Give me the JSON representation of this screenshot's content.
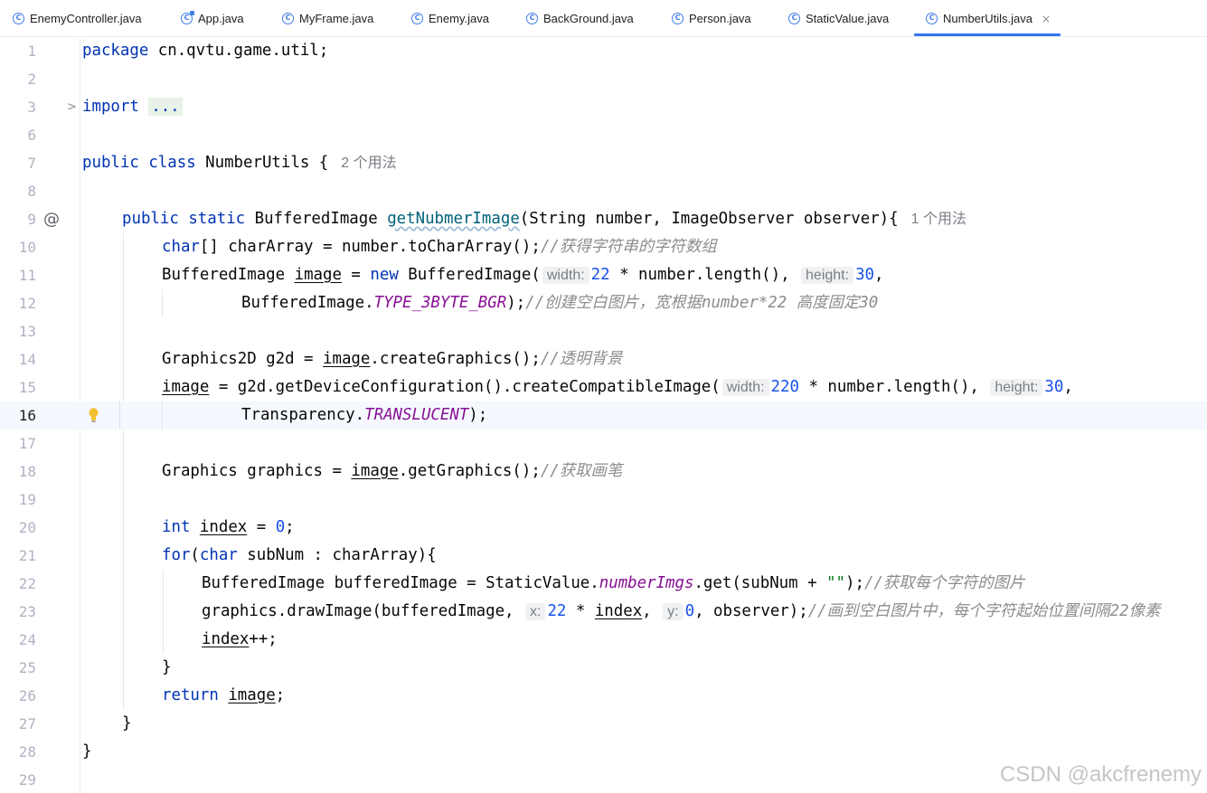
{
  "tabs": [
    {
      "label": "EnemyController.java",
      "icon": "class-icon"
    },
    {
      "label": "App.java",
      "icon": "app-class-icon"
    },
    {
      "label": "MyFrame.java",
      "icon": "class-icon"
    },
    {
      "label": "Enemy.java",
      "icon": "class-icon"
    },
    {
      "label": "BackGround.java",
      "icon": "class-icon"
    },
    {
      "label": "Person.java",
      "icon": "class-icon"
    },
    {
      "label": "StaticValue.java",
      "icon": "class-icon"
    },
    {
      "label": "NumberUtils.java",
      "icon": "class-icon",
      "active": true
    }
  ],
  "tab_close_glyph": "×",
  "active_tab_color": "#3574f0",
  "gutter": {
    "at_symbol": "@",
    "fold_arrow": ">"
  },
  "line_numbers": [
    "1",
    "2",
    "3",
    "6",
    "7",
    "8",
    "9",
    "10",
    "11",
    "12",
    "13",
    "14",
    "15",
    "16",
    "17",
    "18",
    "19",
    "20",
    "21",
    "22",
    "23",
    "24",
    "25",
    "26",
    "27",
    "28",
    "29"
  ],
  "current_line": "16",
  "code": {
    "l1": {
      "kw": "package",
      "rest": " cn.qvtu.game.util;"
    },
    "l3": {
      "kw": "import",
      "dots": "..."
    },
    "l7": {
      "kw1": "public",
      "kw2": "class",
      "name": " NumberUtils {",
      "usage": "2 个用法"
    },
    "l9": {
      "kw1": "public",
      "kw2": "static",
      "type": " BufferedImage ",
      "fn": "getNubmerImage",
      "params": "(String number, ImageObserver observer){",
      "usage": "1 个用法"
    },
    "l10": {
      "kw": "char",
      "rest": "[] charArray = number.toCharArray();",
      "comment": "//获得字符串的字符数组"
    },
    "l11": {
      "pre": "BufferedImage ",
      "var": "image",
      "mid": " = ",
      "kw": "new",
      "mid2": " BufferedImage(",
      "hint1": "width:",
      "num1": "22",
      "mid3": " * number.length(), ",
      "hint2": "height:",
      "num2": "30",
      "end": ","
    },
    "l12": {
      "pre": "BufferedImage.",
      "const": "TYPE_3BYTE_BGR",
      "end": ");",
      "comment": "//创建空白图片，宽根据number*22 高度固定30"
    },
    "l14": {
      "pre": "Graphics2D g2d = ",
      "var": "image",
      "end": ".createGraphics();",
      "comment": "//透明背景"
    },
    "l15": {
      "var": "image",
      "mid": " = g2d.getDeviceConfiguration().createCompatibleImage(",
      "hint1": "width:",
      "num1": "220",
      "mid2": " * number.length(), ",
      "hint2": "height:",
      "num2": "30",
      "end": ","
    },
    "l16": {
      "pre": "Transparency.",
      "const": "TRANSLUCENT",
      "end": ");"
    },
    "l18": {
      "pre": "Graphics graphics = ",
      "var": "image",
      "end": ".getGraphics();",
      "comment": "//获取画笔"
    },
    "l20": {
      "kw": "int",
      "sp": " ",
      "var": "index",
      "mid": " = ",
      "num": "0",
      "end": ";"
    },
    "l21": {
      "kw": "for",
      "p1": "(",
      "kw2": "char",
      "rest": " subNum : charArray){"
    },
    "l22": {
      "pre": "BufferedImage bufferedImage = StaticValue.",
      "field": "numberImgs",
      "mid": ".get(subNum + ",
      "str": "\"\"",
      "end": ");",
      "comment": "//获取每个字符的图片"
    },
    "l23": {
      "pre": "graphics.drawImage(bufferedImage, ",
      "hint1": "x:",
      "num1": "22",
      "mid": " * ",
      "var": "index",
      "mid2": ", ",
      "hint2": "y:",
      "num2": "0",
      "end": ", observer);",
      "comment": "//画到空白图片中，每个字符起始位置间隔22像素"
    },
    "l24": {
      "var": "index",
      "end": "++;"
    },
    "l25": {
      "text": "}"
    },
    "l26": {
      "kw": "return",
      "sp": " ",
      "var": "image",
      "end": ";"
    },
    "l27": {
      "text": "}"
    },
    "l28": {
      "text": "}"
    }
  },
  "watermark": "CSDN @akcfrenemy"
}
